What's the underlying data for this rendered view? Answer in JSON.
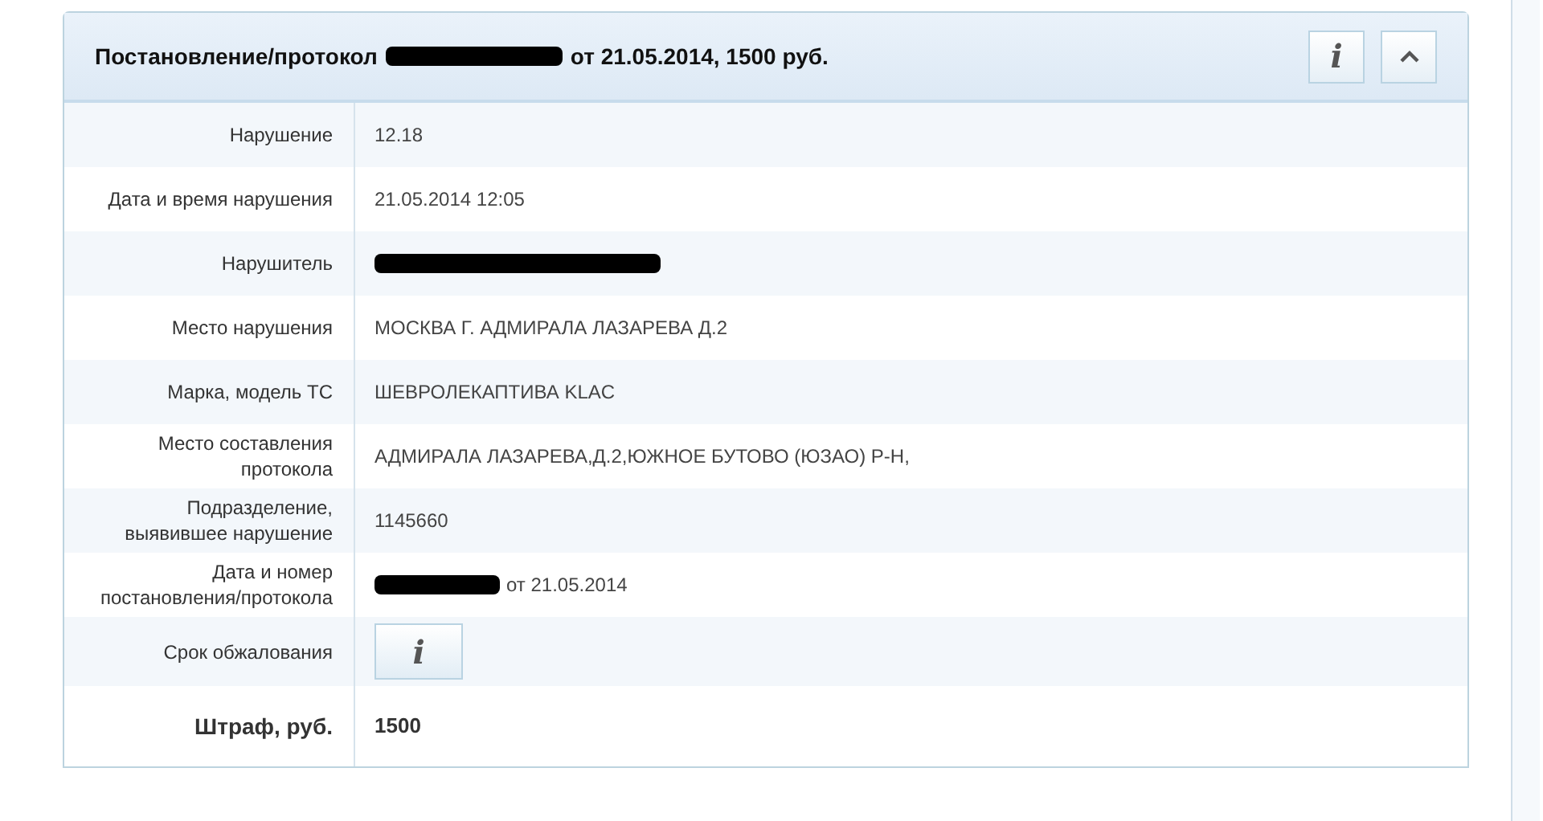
{
  "header": {
    "title_before": "Постановление/протокол",
    "title_redacted": true,
    "title_after": "от 21.05.2014, 1500 руб.",
    "info_button": "i",
    "collapse_expanded": true
  },
  "rows": [
    {
      "label": "Нарушение",
      "kind": "text",
      "value": "12.18"
    },
    {
      "label": "Дата и время нарушения",
      "kind": "text",
      "value": "21.05.2014 12:05"
    },
    {
      "label": "Нарушитель",
      "kind": "redacted"
    },
    {
      "label": "Место нарушения",
      "kind": "text",
      "value": "МОСКВА Г. АДМИРАЛА ЛАЗАРЕВА Д.2"
    },
    {
      "label": "Марка, модель ТС",
      "kind": "text",
      "value": "ШЕВРОЛЕКАПТИВА KLAC"
    },
    {
      "label": "Место составления протокола",
      "kind": "text",
      "value": "АДМИРАЛА ЛАЗАРЕВА,Д.2,ЮЖНОЕ БУТОВО (ЮЗАО) Р-Н,"
    },
    {
      "label": "Подразделение, выявившее нарушение",
      "kind": "text",
      "value": "1145660"
    },
    {
      "label": "Дата и номер постановления/протокола",
      "kind": "redacted",
      "value": "от 21.05.2014"
    },
    {
      "label": "Срок обжалования",
      "kind": "button",
      "value": "i"
    },
    {
      "label": "Штраф, руб.",
      "kind": "bold",
      "value": "1500"
    }
  ]
}
